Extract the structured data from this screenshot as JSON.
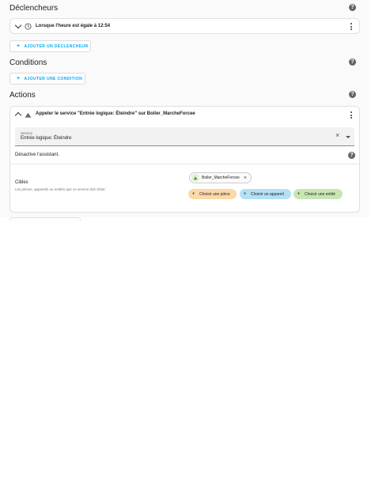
{
  "triggers": {
    "title": "Déclencheurs",
    "item_label": "Lorsque l'heure est égale à 12:54",
    "add_button": "AJOUTER UN DÉCLENCHEUR"
  },
  "conditions": {
    "title": "Conditions",
    "add_button": "AJOUTER UNE CONDITION"
  },
  "actions": {
    "title": "Actions",
    "item_label": "Appeler le service \"Entrée logique: Éteindre\" sur Boiler_MarcheForcee",
    "service_label": "Service",
    "service_value": "Entrée logique: Éteindre",
    "service_description": "Désactive l'assistant.",
    "targets_title": "Cibles",
    "targets_description": "Les pièces, appareils ou entités que ce service doit cibler.",
    "selected_target": "Boiler_MarcheForcee",
    "choose_area": "Choisir une pièce",
    "choose_device": "Choisir un appareil",
    "choose_entity": "Choisir une entité"
  },
  "colors": {
    "accent": "#03a9f4",
    "area_chip": "#fdd8a8",
    "device_chip": "#b3e0f5",
    "entity_chip": "#c8e6b4"
  },
  "icons": {
    "help": "help-circle-icon",
    "clock": "clock-icon",
    "service": "home-assistant-icon",
    "menu": "dots-vertical-icon"
  }
}
